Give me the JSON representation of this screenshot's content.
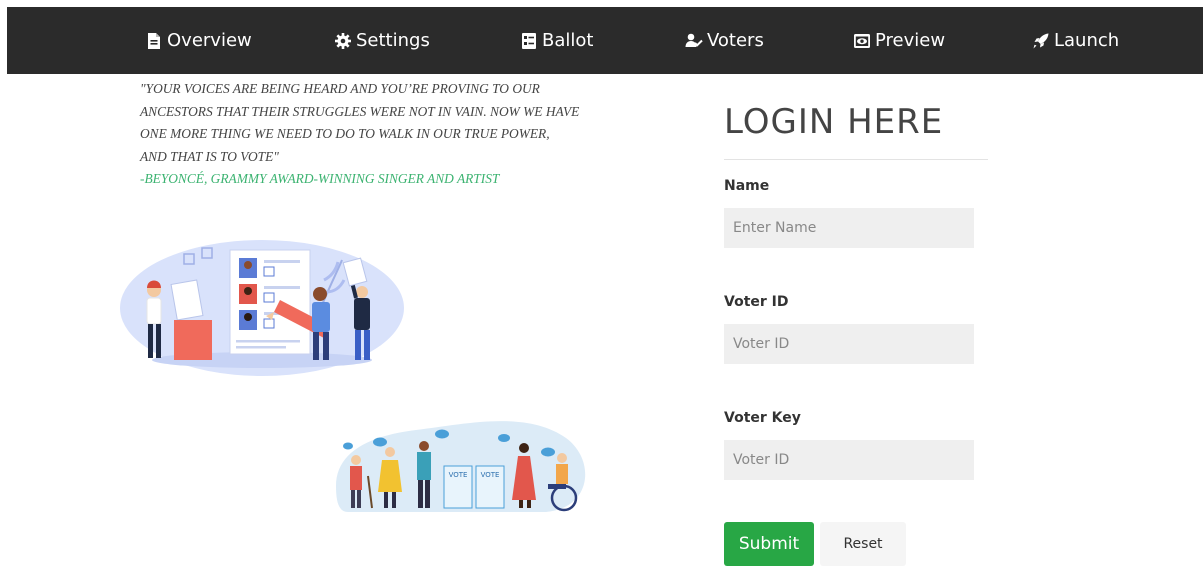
{
  "nav": {
    "items": [
      {
        "label": "Overview",
        "icon": "document-icon"
      },
      {
        "label": "Settings",
        "icon": "gear-icon"
      },
      {
        "label": "Ballot",
        "icon": "ballot-icon"
      },
      {
        "label": "Voters",
        "icon": "voters-icon"
      },
      {
        "label": "Preview",
        "icon": "preview-icon"
      },
      {
        "label": "Launch",
        "icon": "rocket-icon"
      }
    ]
  },
  "quote": {
    "lines": [
      "\"Your voices are being heard and you’re proving to our",
      "ancestors that their struggles were not in vain. Now we have",
      "one more thing we need to do to walk in our true power,",
      "and that is to vote\""
    ],
    "attribution": "-Beyoncé, Grammy Award-winning singer and artist"
  },
  "illustration": {
    "ballot_box_labels": [
      "VOTE",
      "VOTE"
    ]
  },
  "login": {
    "title": "LOGIN HERE",
    "fields": [
      {
        "label": "Name",
        "placeholder": "Enter Name",
        "value": ""
      },
      {
        "label": "Voter ID",
        "placeholder": "Voter ID",
        "value": ""
      },
      {
        "label": "Voter Key",
        "placeholder": "Voter ID",
        "value": ""
      }
    ],
    "submit_label": "Submit",
    "reset_label": "Reset"
  },
  "colors": {
    "navbar": "#2b2b2b",
    "accent_green": "#28a745",
    "quote_attribution": "#3cb371",
    "input_bg": "#efefef"
  }
}
